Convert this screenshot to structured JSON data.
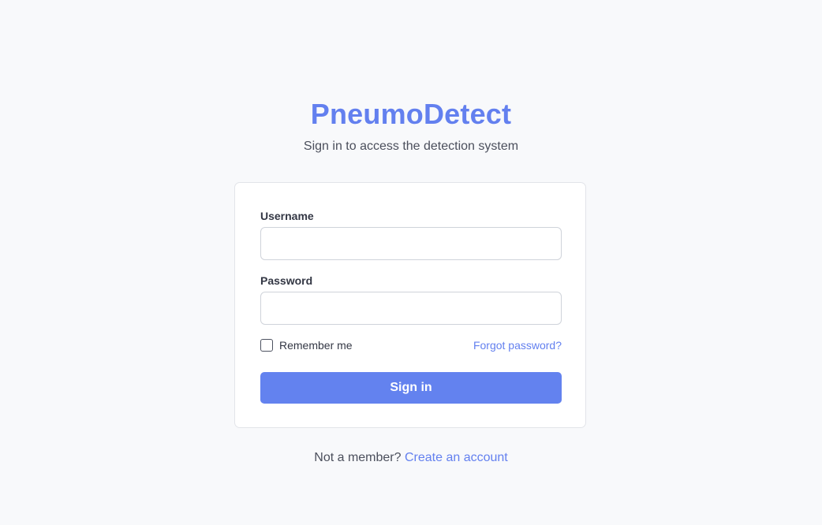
{
  "header": {
    "brand": "PneumoDetect",
    "subtitle": "Sign in to access the detection system"
  },
  "form": {
    "username_label": "Username",
    "username_value": "",
    "password_label": "Password",
    "password_value": "",
    "remember_label": "Remember me",
    "remember_checked": false,
    "forgot_link": "Forgot password?",
    "submit_label": "Sign in"
  },
  "footer": {
    "prompt": "Not a member?",
    "signup_link": "Create an account"
  },
  "colors": {
    "accent": "#6380ef",
    "background": "#f8f9fb",
    "card": "#ffffff"
  }
}
